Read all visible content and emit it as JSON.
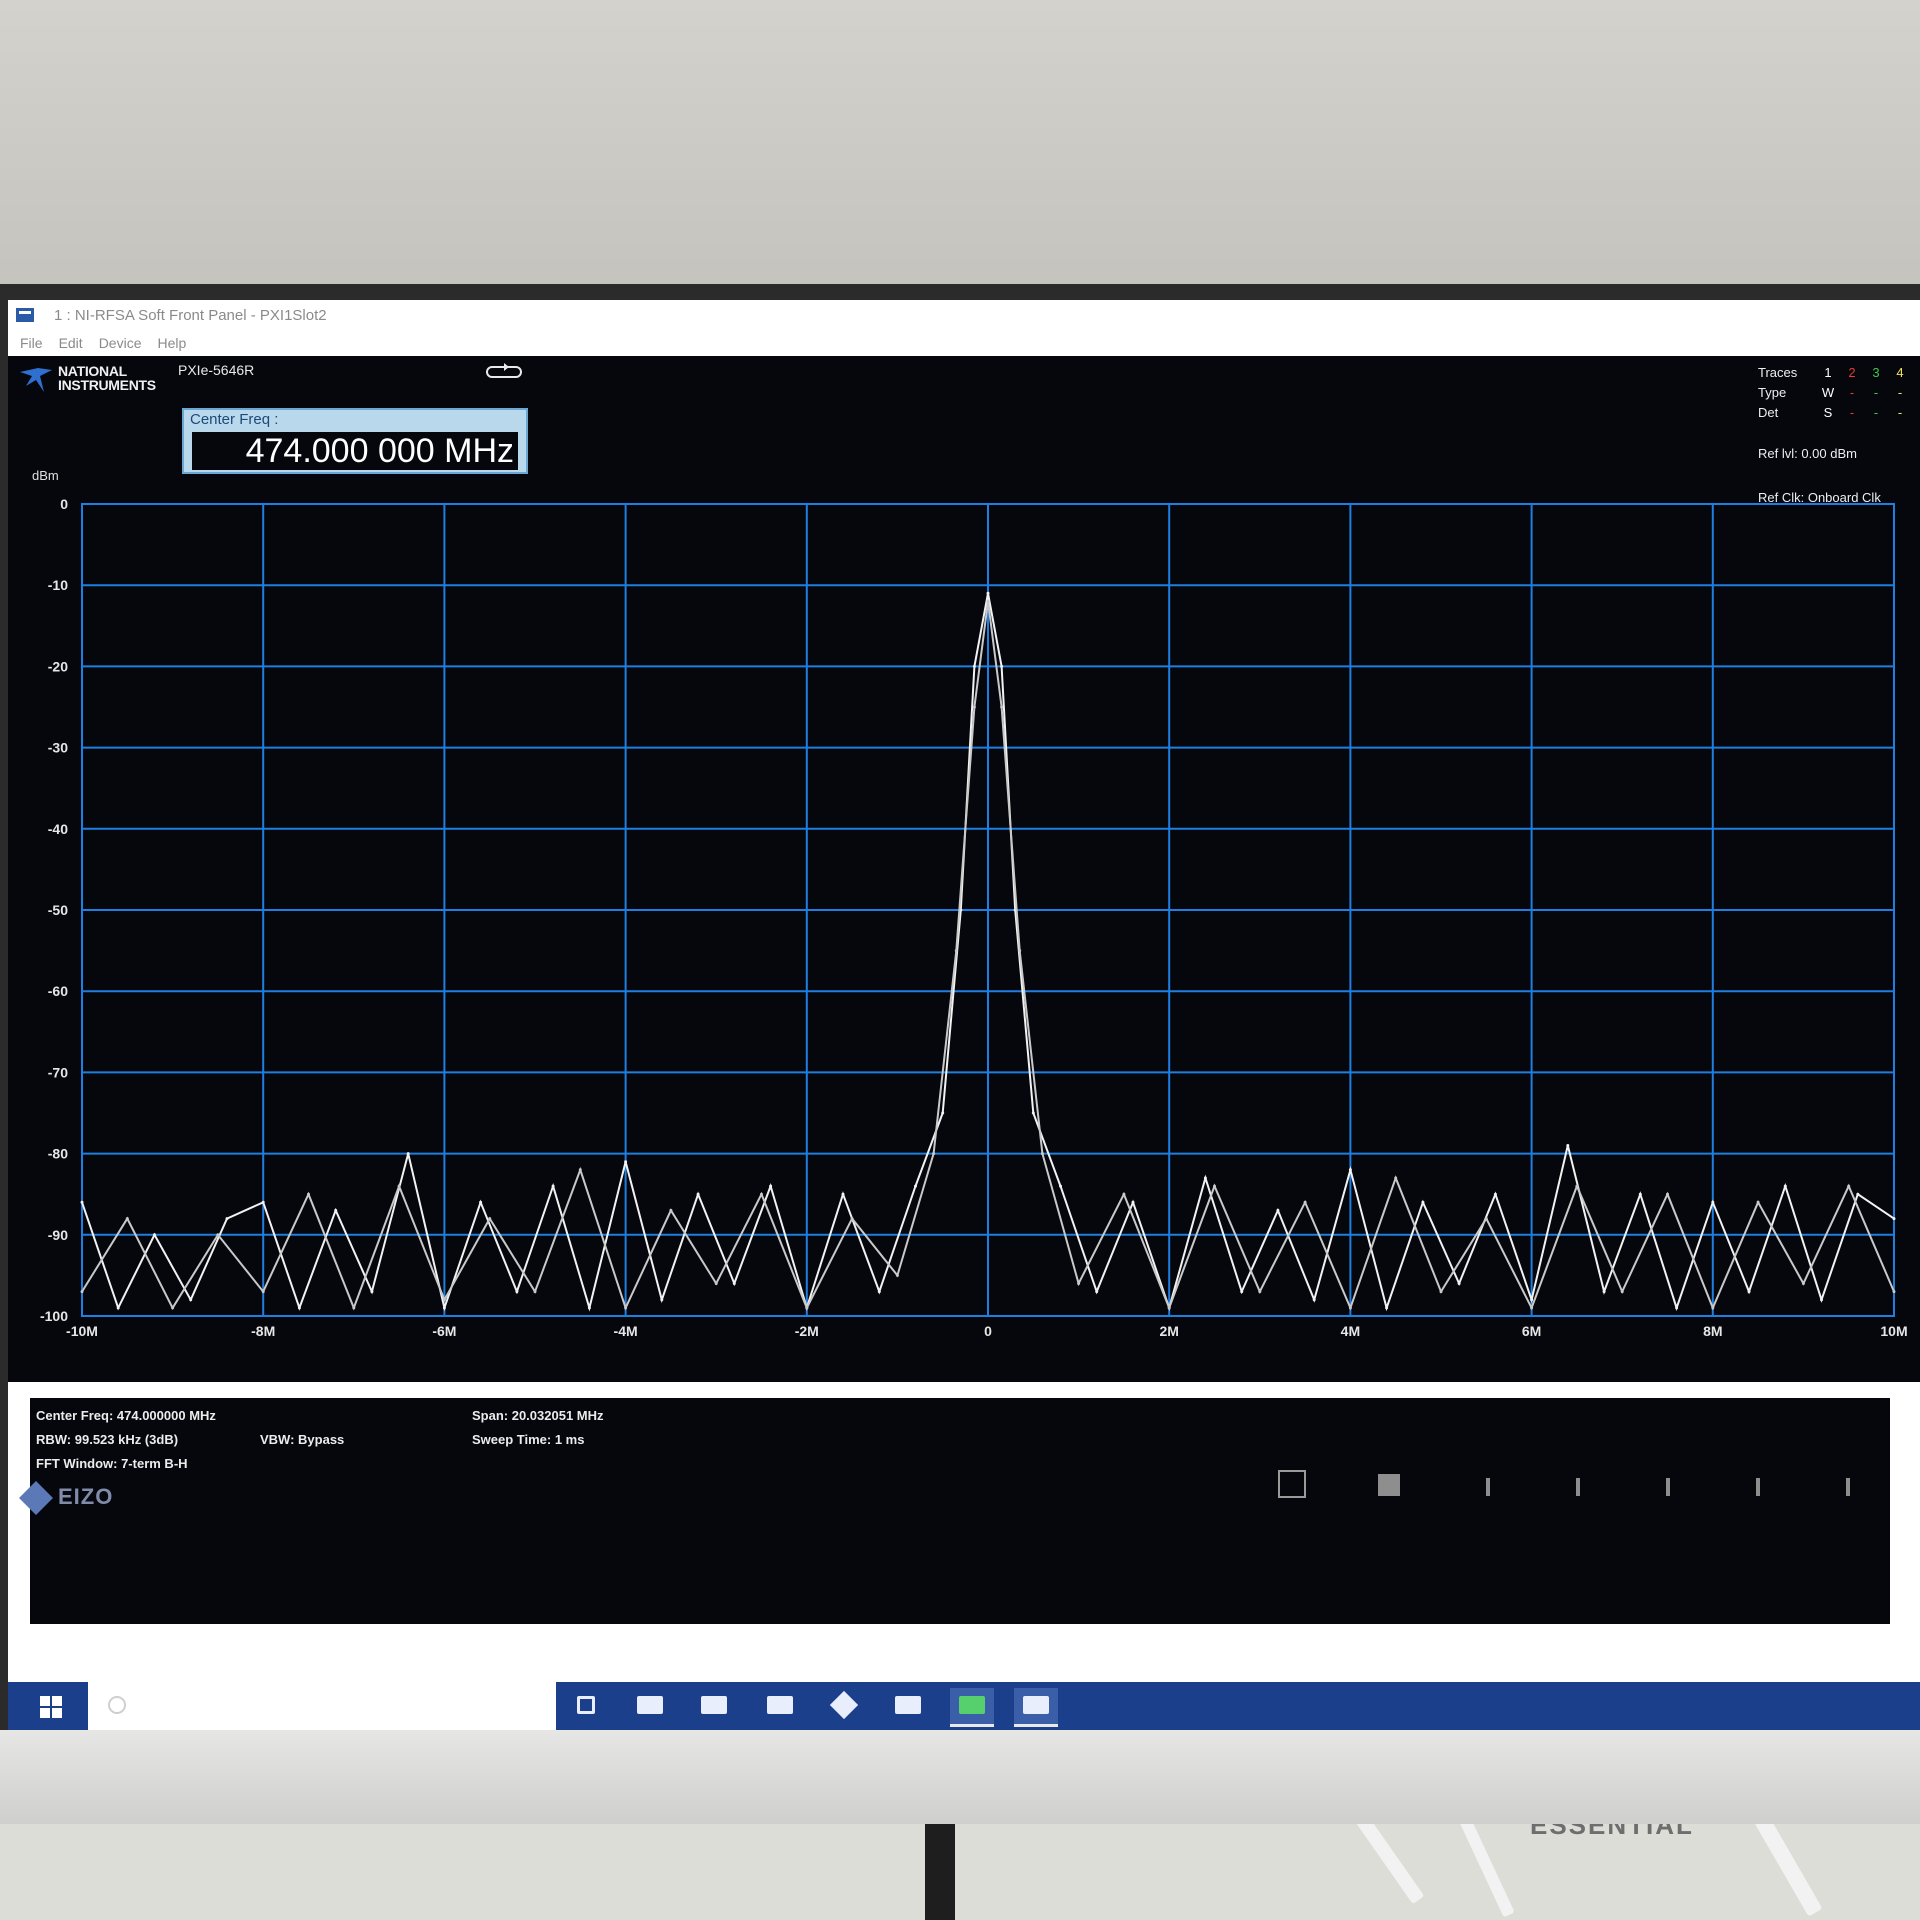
{
  "window": {
    "title": "1 : NI-RFSA Soft Front Panel - PXI1Slot2",
    "menu": [
      "File",
      "Edit",
      "Device",
      "Help"
    ]
  },
  "panel": {
    "brand": "NATIONAL INSTRUMENTS",
    "device": "PXIe-5646R",
    "center_freq_label": "Center Freq :",
    "center_freq_value": "474.000 000 MHz",
    "traces": {
      "label": "Traces",
      "numbers": [
        "1",
        "2",
        "3",
        "4"
      ],
      "type_label": "Type",
      "type_values": [
        "W",
        "-",
        "-",
        "-"
      ],
      "det_label": "Det",
      "det_values": [
        "S",
        "-",
        "-",
        "-"
      ],
      "colors": [
        "#ffffff",
        "#e53935",
        "#43c54a",
        "#f2e15a"
      ]
    },
    "ref_level": "Ref lvl: 0.00 dBm",
    "ref_clock": "Ref Clk: Onboard Clk"
  },
  "chart_data": {
    "type": "line",
    "ylabel": "dBm",
    "ylim": [
      -100,
      0
    ],
    "xlim": [
      -10,
      10
    ],
    "grid": true,
    "y_ticks": [
      "0",
      "-10",
      "-20",
      "-30",
      "-40",
      "-50",
      "-60",
      "-70",
      "-80",
      "-90",
      "-100"
    ],
    "x_ticks": [
      "-10M",
      "-8M",
      "-6M",
      "-4M",
      "-2M",
      "0",
      "2M",
      "4M",
      "6M",
      "8M",
      "10M"
    ],
    "x_tick_values": [
      -10,
      -8,
      -6,
      -4,
      -2,
      0,
      2,
      4,
      6,
      8,
      10
    ],
    "series": [
      {
        "x": [
          -10,
          -9.6,
          -9.2,
          -8.8,
          -8.4,
          -8,
          -7.6,
          -7.2,
          -6.8,
          -6.4,
          -6,
          -5.6,
          -5.2,
          -4.8,
          -4.4,
          -4,
          -3.6,
          -3.2,
          -2.8,
          -2.4,
          -2,
          -1.6,
          -1.2,
          -0.8,
          -0.5,
          -0.3,
          -0.15,
          0,
          0.15,
          0.3,
          0.5,
          0.8,
          1.2,
          1.6,
          2,
          2.4,
          2.8,
          3.2,
          3.6,
          4,
          4.4,
          4.8,
          5.2,
          5.6,
          6,
          6.4,
          6.8,
          7.2,
          7.6,
          8,
          8.4,
          8.8,
          9.2,
          9.6,
          10
        ],
        "y": [
          -86,
          -99,
          -90,
          -98,
          -88,
          -86,
          -99,
          -87,
          -97,
          -80,
          -99,
          -86,
          -97,
          -84,
          -99,
          -81,
          -98,
          -85,
          -96,
          -84,
          -99,
          -85,
          -97,
          -84,
          -75,
          -50,
          -20,
          -11,
          -20,
          -50,
          -75,
          -84,
          -97,
          -86,
          -99,
          -83,
          -97,
          -87,
          -98,
          -82,
          -99,
          -86,
          -96,
          -85,
          -98,
          -79,
          -97,
          -85,
          -99,
          -86,
          -97,
          -84,
          -98,
          -85,
          -88
        ]
      },
      {
        "x": [
          -10,
          -9.5,
          -9,
          -8.5,
          -8,
          -7.5,
          -7,
          -6.5,
          -6,
          -5.5,
          -5,
          -4.5,
          -4,
          -3.5,
          -3,
          -2.5,
          -2,
          -1.5,
          -1,
          -0.6,
          -0.35,
          -0.15,
          0,
          0.15,
          0.35,
          0.6,
          1,
          1.5,
          2,
          2.5,
          3,
          3.5,
          4,
          4.5,
          5,
          5.5,
          6,
          6.5,
          7,
          7.5,
          8,
          8.5,
          9,
          9.5,
          10
        ],
        "y": [
          -97,
          -88,
          -99,
          -90,
          -97,
          -85,
          -99,
          -84,
          -98,
          -88,
          -97,
          -82,
          -99,
          -87,
          -96,
          -85,
          -99,
          -88,
          -95,
          -80,
          -55,
          -25,
          -12,
          -25,
          -55,
          -80,
          -96,
          -85,
          -99,
          -84,
          -97,
          -86,
          -99,
          -83,
          -97,
          -88,
          -99,
          -84,
          -97,
          -85,
          -99,
          -86,
          -96,
          -84,
          -97
        ]
      }
    ]
  },
  "info": {
    "center_freq": "Center Freq: 474.000000 MHz",
    "rbw": "RBW: 99.523 kHz (3dB)",
    "vbw": "VBW: Bypass",
    "fft_window": "FFT Window: 7-term B-H",
    "span": "Span: 20.032051 MHz",
    "sweep_time": "Sweep Time: 1 ms"
  },
  "bezel": {
    "brand": "EIZO",
    "model_text": "ESSENTIAL"
  }
}
